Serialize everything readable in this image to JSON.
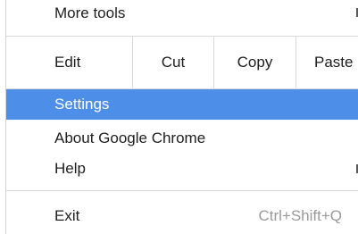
{
  "menu": {
    "more_tools": "More tools",
    "edit": {
      "label": "Edit",
      "cut": "Cut",
      "copy": "Copy",
      "paste": "Paste"
    },
    "settings": "Settings",
    "about": "About Google Chrome",
    "help": "Help",
    "exit": {
      "label": "Exit",
      "shortcut": "Ctrl+Shift+Q"
    }
  },
  "colors": {
    "highlight": "#4d8fe8",
    "shortcut_text": "#9a9a9a",
    "separator": "#d8d8d8"
  }
}
